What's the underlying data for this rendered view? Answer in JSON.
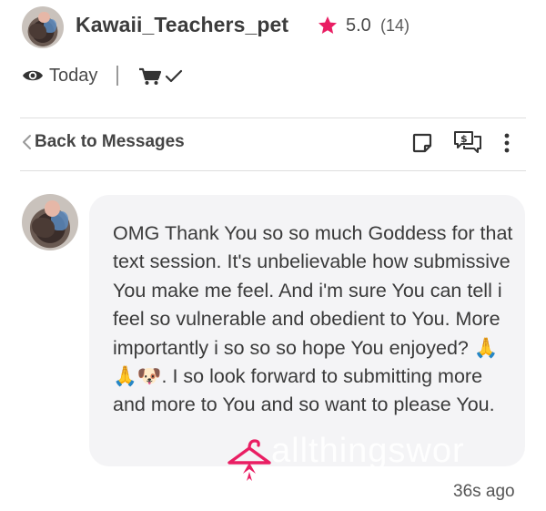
{
  "header": {
    "username": "Kawaii_Teachers_pet",
    "rating": "5.0",
    "rating_count": "(14)",
    "status_text": "Today"
  },
  "toolbar": {
    "back_label": "Back to Messages"
  },
  "message": {
    "text": "OMG Thank You so so much Goddess for that text session. It's unbelievable how submissive You make me feel. And i'm sure You can tell i feel so vulnerable and obedient to You. More importantly i so so so hope You enjoyed? 🙏🙏🐶. I so look forward to submitting more and more to You and so want to please You.",
    "timestamp": "36s ago",
    "watermark": "allthingswor"
  },
  "colors": {
    "accent": "#e91e63",
    "bubble": "#f4f4f6",
    "divider": "#dedede"
  },
  "icons": [
    "avatar",
    "star-icon",
    "eye-icon",
    "cart-icon",
    "check-icon",
    "chevron-left-icon",
    "note-icon",
    "money-chat-icon",
    "more-vert-icon",
    "hanger-logo-icon"
  ]
}
